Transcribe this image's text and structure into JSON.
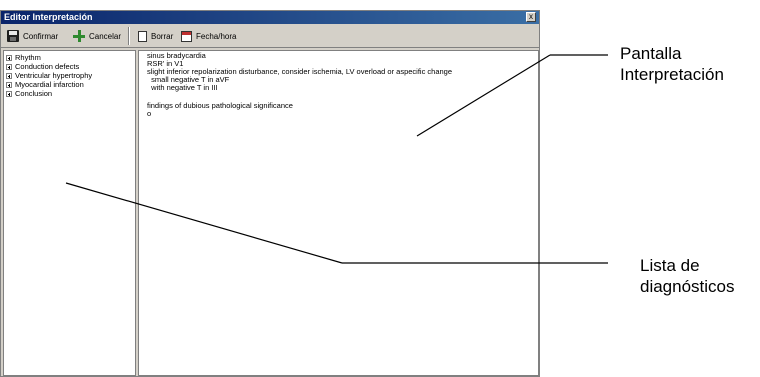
{
  "window": {
    "title": "Editor Interpretación",
    "close_glyph": "x"
  },
  "toolbar": {
    "confirm_label": "Confirmar",
    "cancel_label": "Cancelar",
    "delete_label": "Borrar",
    "date_label": "Fecha/hora"
  },
  "tree": {
    "items": [
      "Rhythm",
      "Conduction defects",
      "Ventricular hypertrophy",
      "Myocardial infarction",
      "Conclusion"
    ]
  },
  "editor": {
    "lines": [
      "sinus bradycardia",
      "RSR' in V1",
      "slight inferior repolarization disturbance, consider ischemia, LV overload or aspecific change",
      "  small negative T in aVF",
      "  with negative T in III",
      "",
      "findings of dubious pathological significance",
      "o"
    ]
  },
  "callouts": {
    "screen_line1": "Pantalla",
    "screen_line2": "Interpretación",
    "list_line1": "Lista de",
    "list_line2": "diagnósticos"
  }
}
